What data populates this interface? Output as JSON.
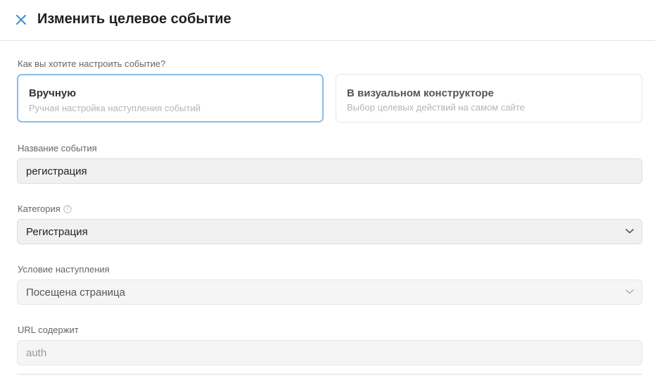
{
  "header": {
    "title": "Изменить целевое событие"
  },
  "setup": {
    "question": "Как вы хотите настроить событие?",
    "options": [
      {
        "title": "Вручную",
        "subtitle": "Ручная настройка наступления событий",
        "selected": true
      },
      {
        "title": "В визуальном конструкторе",
        "subtitle": "Выбор целевых действий на самом сайте",
        "selected": false
      }
    ]
  },
  "event_name": {
    "label": "Название события",
    "value": "регистрация"
  },
  "category": {
    "label": "Категория",
    "value": "Регистрация"
  },
  "condition": {
    "label": "Условие наступления",
    "value": "Посещена страница"
  },
  "url": {
    "label": "URL содержит",
    "value": "auth"
  },
  "colors": {
    "accent": "#3d8fd6",
    "selected_border": "#8cbde6"
  },
  "icons": {
    "close": "close-icon",
    "help": "help-circle-icon",
    "dropdown": "chevron-down-icon"
  }
}
